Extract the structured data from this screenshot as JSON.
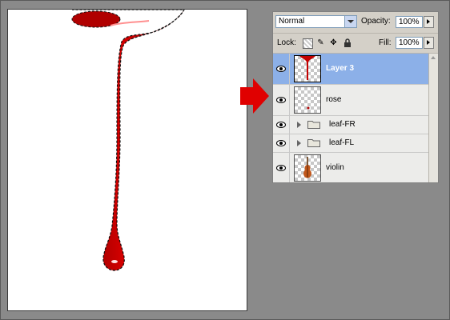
{
  "arrow_color": "#e00000",
  "layers_panel": {
    "blend_mode": "Normal",
    "opacity_label": "Opacity:",
    "opacity_value": "100%",
    "lock_label": "Lock:",
    "fill_label": "Fill:",
    "fill_value": "100%",
    "layers": [
      {
        "name": "Layer 3",
        "type": "layer",
        "selected": true,
        "thumbnail": "red-drip-thumbnail"
      },
      {
        "name": "rose",
        "type": "layer",
        "selected": false,
        "thumbnail": "rose-thumbnail"
      },
      {
        "name": "leaf-FR",
        "type": "group",
        "selected": false
      },
      {
        "name": "leaf-FL",
        "type": "group",
        "selected": false
      },
      {
        "name": "violin",
        "type": "layer",
        "selected": false,
        "thumbnail": "violin-thumbnail"
      }
    ]
  },
  "colors": {
    "drip": "#c40000",
    "selection_highlight": "#8cb0e8"
  }
}
